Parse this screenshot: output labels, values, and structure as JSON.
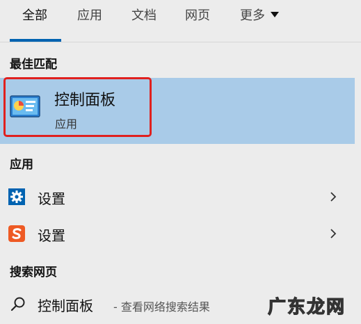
{
  "tabs": [
    "全部",
    "应用",
    "文档",
    "网页",
    "更多"
  ],
  "sections": {
    "best_match": "最佳匹配",
    "apps": "应用",
    "web": "搜索网页"
  },
  "best": {
    "title": "控制面板",
    "subtitle": "应用"
  },
  "apps": [
    {
      "label": "设置",
      "icon": "gear-icon"
    },
    {
      "label": "设置",
      "icon": "sogou-s-icon"
    }
  ],
  "web_search": {
    "query": "控制面板",
    "hint": "- 查看网络搜索结果"
  },
  "watermark": "广东龙网",
  "colors": {
    "accent": "#0063b1",
    "selection": "#a9cbe8",
    "highlight_outline": "#e0201e",
    "sogou": "#ee5a24"
  }
}
